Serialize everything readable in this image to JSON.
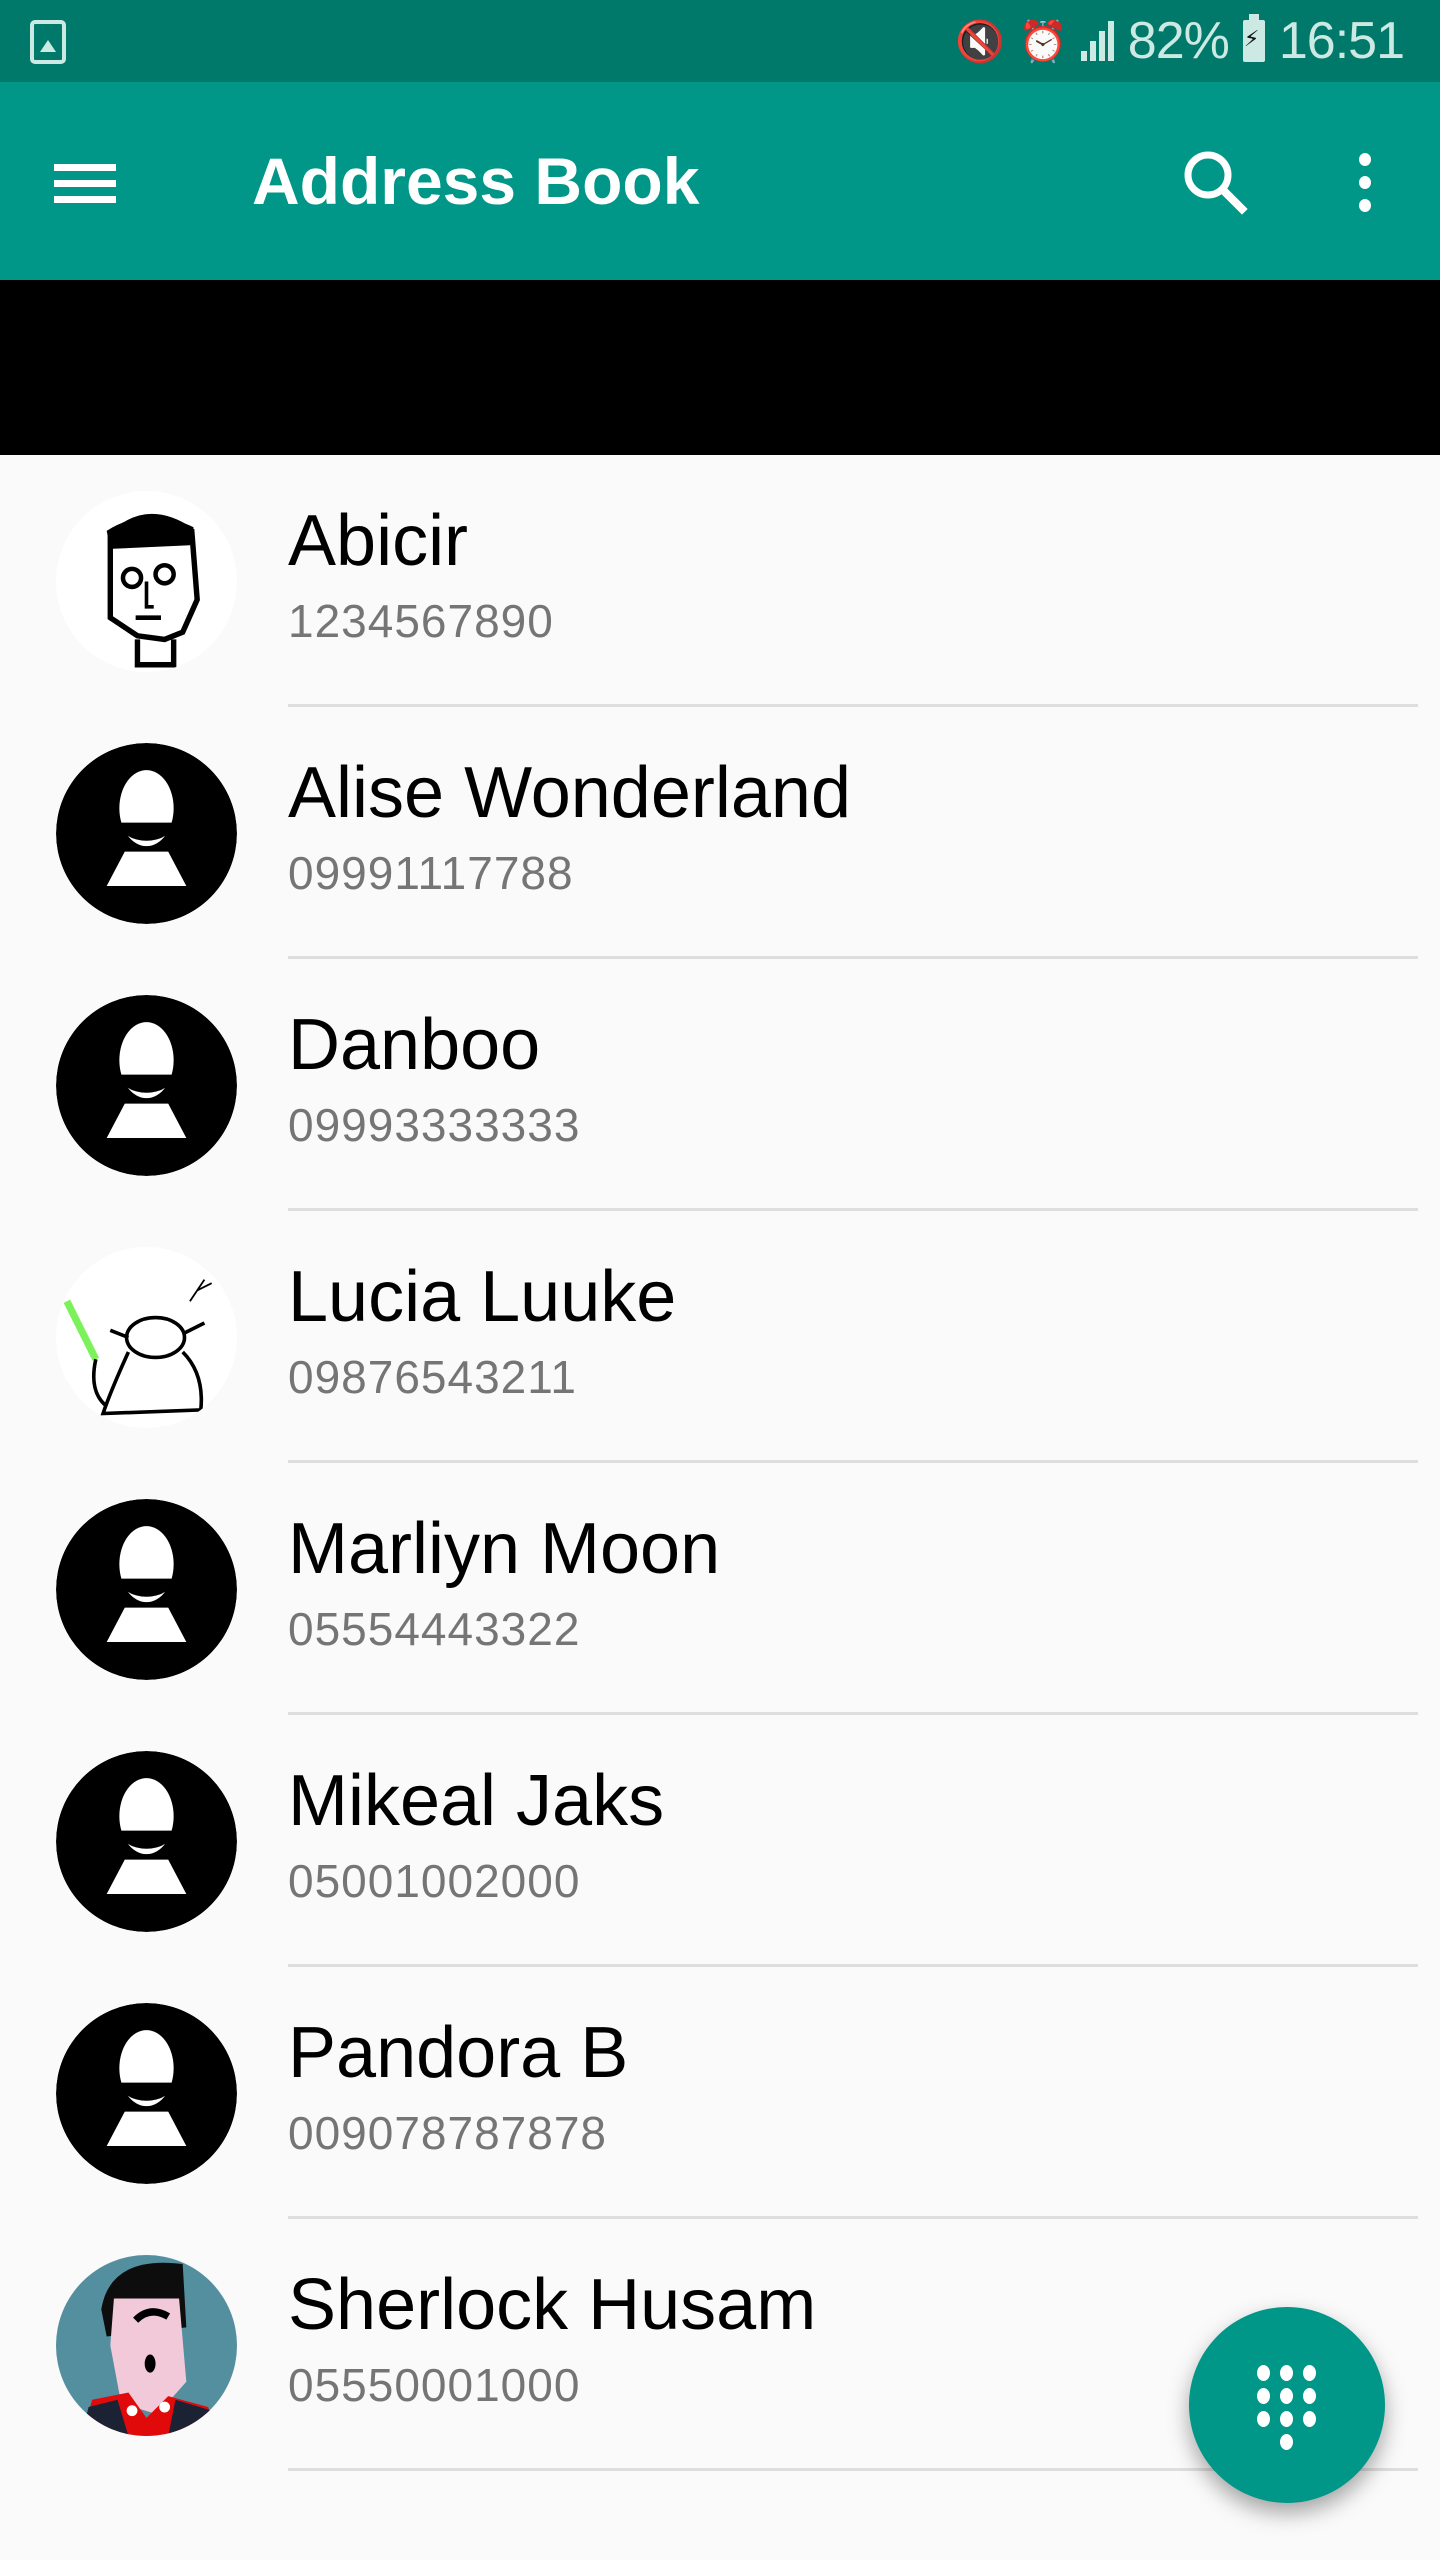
{
  "status_bar": {
    "left_icon": "image-notification-icon",
    "icons": [
      "vibrate-mute-icon",
      "alarm-icon",
      "signal-icon"
    ],
    "battery_percent": "82%",
    "battery_icon": "battery-charging-icon",
    "time": "16:51"
  },
  "app_bar": {
    "title": "Address Book",
    "menu_icon": "hamburger-menu-icon",
    "search_icon": "search-icon",
    "more_icon": "more-vert-icon",
    "background_color": "#009688"
  },
  "contacts": [
    {
      "name": "Abicir",
      "phone": "1234567890",
      "avatar": "sketch-face-photo"
    },
    {
      "name": "Alise Wonderland",
      "phone": "09991117788",
      "avatar": "default-person"
    },
    {
      "name": "Danboo",
      "phone": "09993333333",
      "avatar": "default-person"
    },
    {
      "name": "Lucia Luuke",
      "phone": "09876543211",
      "avatar": "yoda-sketch-photo"
    },
    {
      "name": "Marliyn Moon",
      "phone": "05554443322",
      "avatar": "default-person"
    },
    {
      "name": "Mikeal Jaks",
      "phone": "05001002000",
      "avatar": "default-person"
    },
    {
      "name": "Pandora B",
      "phone": "009078787878",
      "avatar": "default-person"
    },
    {
      "name": "Sherlock Husam",
      "phone": "05550001000",
      "avatar": "cartoon-portrait-photo"
    }
  ],
  "fab": {
    "icon": "dialpad-icon",
    "color": "#009688"
  }
}
